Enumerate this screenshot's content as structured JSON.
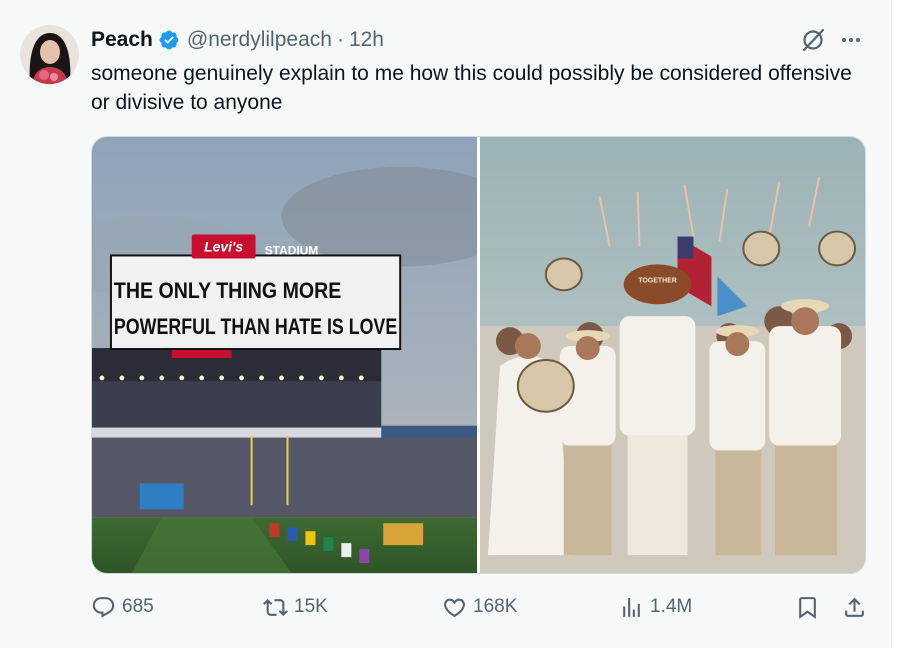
{
  "post": {
    "author_name": "Peach",
    "handle": "@nerdylilpeach",
    "separator": "·",
    "time": "12h",
    "text": "someone genuinely explain to me how this could possibly be considered offensive or divisive to anyone",
    "verified": true
  },
  "media": {
    "left_photo": {
      "sign_brand": "Levi's",
      "sign_stadium": "STADIUM",
      "scoreboard_line1": "THE ONLY THING MORE",
      "scoreboard_line2": "POWERFUL THAN HATE IS LOVE"
    },
    "right_photo": {
      "football_text": "TOGETHER"
    }
  },
  "actions": {
    "replies": "685",
    "reposts": "15K",
    "likes": "168K",
    "views": "1.4M"
  },
  "icons": {
    "reply": "reply-icon",
    "repost": "repost-icon",
    "like": "heart-icon",
    "views": "views-icon",
    "bookmark": "bookmark-icon",
    "share": "share-icon",
    "grok": "grok-icon",
    "more": "more-icon",
    "verified": "verified-badge-icon"
  },
  "colors": {
    "text_primary": "#0f1419",
    "text_secondary": "#536471",
    "verified_blue": "#1d9bf0",
    "card_background": "#f7f9f9"
  }
}
